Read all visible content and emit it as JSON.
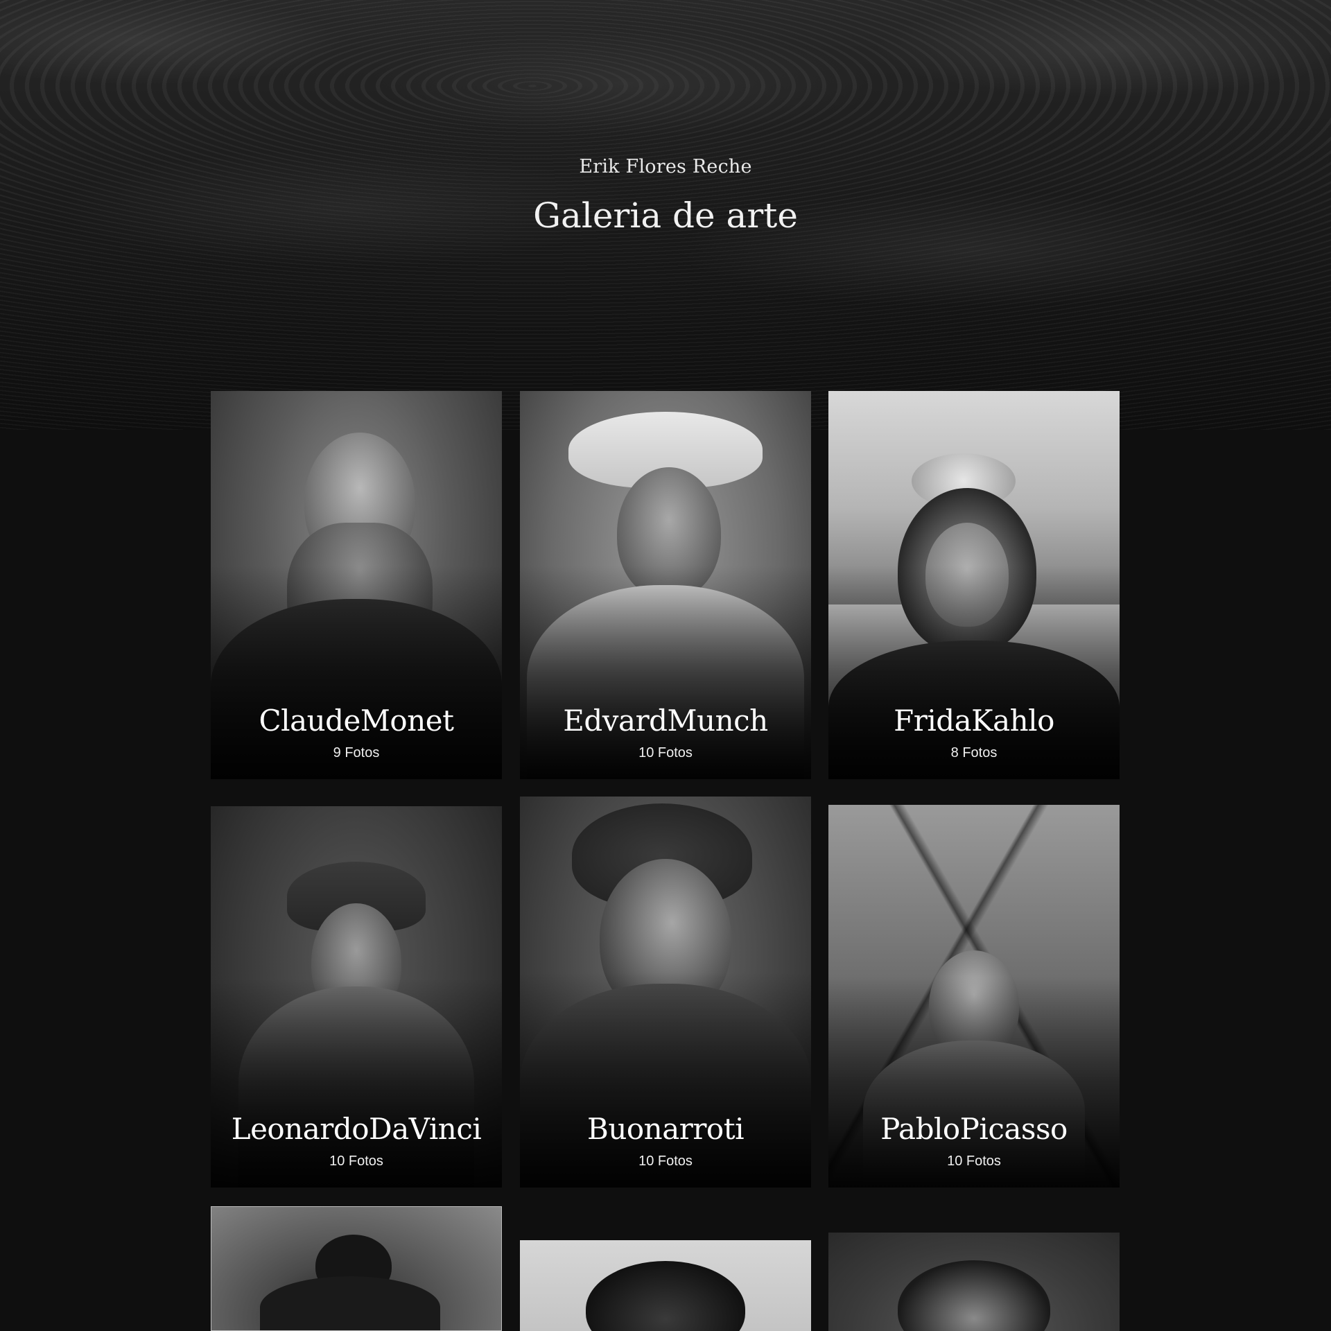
{
  "header": {
    "author": "Erik Flores Reche",
    "title": "Galeria de arte"
  },
  "artists": [
    {
      "name": "ClaudeMonet",
      "count": "9 Fotos"
    },
    {
      "name": "EdvardMunch",
      "count": "10 Fotos"
    },
    {
      "name": "FridaKahlo",
      "count": "8 Fotos"
    },
    {
      "name": "LeonardoDaVinci",
      "count": "10 Fotos"
    },
    {
      "name": "Buonarroti",
      "count": "10 Fotos"
    },
    {
      "name": "PabloPicasso",
      "count": "10 Fotos"
    }
  ]
}
